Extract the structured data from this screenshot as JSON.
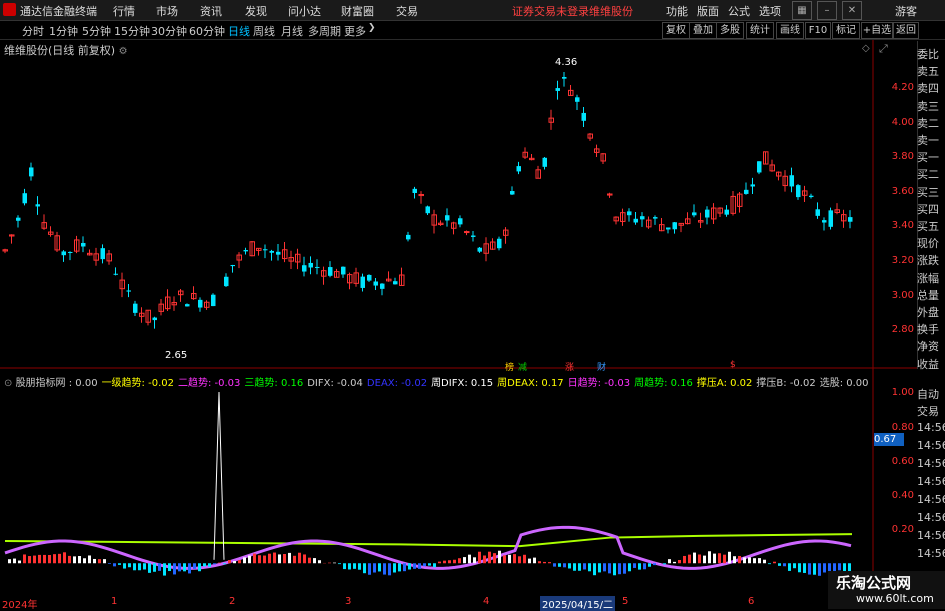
{
  "menubar": {
    "app_title": "通达信金融终端",
    "items": [
      "行情",
      "市场",
      "资讯",
      "发现",
      "问小达",
      "财富圈",
      "交易"
    ],
    "status": "证券交易未登录",
    "stock": "维维股份",
    "right_items": [
      "功能",
      "版面",
      "公式",
      "选项"
    ],
    "user": "游客"
  },
  "toolbar": {
    "periods": [
      "分时",
      "1分钟",
      "5分钟",
      "15分钟",
      "30分钟",
      "60分钟",
      "日线",
      "周线",
      "月线",
      "多周期",
      "更多"
    ],
    "active_period": "日线",
    "more_arrow": "❯",
    "right_buttons": [
      "复权",
      "叠加",
      "多股",
      "统计",
      "画线",
      "F10",
      "标记",
      "+自选",
      "返回"
    ]
  },
  "chart": {
    "title": "维维股份(日线 前复权)",
    "y_ticks": [
      "4.20",
      "4.00",
      "3.80",
      "3.60",
      "3.40",
      "3.20",
      "3.00",
      "2.80"
    ],
    "high_label": "4.36",
    "low_label": "2.65",
    "signals": [
      {
        "text": "榜",
        "color": "#ffcc00"
      },
      {
        "text": "减",
        "color": "#00cc00"
      },
      {
        "text": "涨",
        "color": "#ff3333"
      },
      {
        "text": "财",
        "color": "#3399ff"
      },
      {
        "text": "$",
        "color": "#ff3333"
      }
    ]
  },
  "right_panel": {
    "top": [
      "委比",
      "卖五",
      "卖四",
      "卖三",
      "卖二",
      "卖一",
      "买一",
      "买二",
      "买三",
      "买四",
      "买五",
      "现价",
      "涨跌",
      "涨幅",
      "总量",
      "外盘",
      "换手",
      "净资",
      "收益"
    ],
    "bottom_header": [
      "自动",
      "交易"
    ],
    "times": [
      "14:56",
      "14:56",
      "14:56",
      "14:56",
      "14:56",
      "14:56",
      "14:56",
      "14:56"
    ]
  },
  "indicator": {
    "label_color": "#ccc",
    "parts": [
      {
        "text": "股朋指标网 : 0.00",
        "color": "#cccccc"
      },
      {
        "text": "一级趋势: -0.02",
        "color": "#ffff00"
      },
      {
        "text": "二趋势: -0.03",
        "color": "#ff33ff"
      },
      {
        "text": "三趋势: 0.16",
        "color": "#00ff00"
      },
      {
        "text": "DIFX: -0.04",
        "color": "#cccccc"
      },
      {
        "text": "DEAX: -0.02",
        "color": "#3333ff"
      },
      {
        "text": "周DIFX: 0.15",
        "color": "#ffffff"
      },
      {
        "text": "周DEAX: 0.17",
        "color": "#ffff00"
      },
      {
        "text": "日趋势: -0.03",
        "color": "#ff33ff"
      },
      {
        "text": "周趋势: 0.16",
        "color": "#00ff00"
      },
      {
        "text": "撑压A: 0.02",
        "color": "#ffff00"
      },
      {
        "text": "撑压B: -0.02",
        "color": "#cccccc"
      },
      {
        "text": "选股: 0.00",
        "color": "#cccccc"
      }
    ],
    "y_ticks": [
      "1.00",
      "0.80",
      "0.60",
      "0.40",
      "0.20"
    ],
    "current_value": "0.67"
  },
  "x_axis": {
    "labels": [
      "2024年",
      "1",
      "2",
      "3",
      "4",
      "2025/04/15/二",
      "5",
      "6"
    ]
  },
  "watermark": {
    "title": "乐淘公式网",
    "url": "www.60lt.com"
  },
  "colors": {
    "up": "#ff3333",
    "down": "#00e5ff",
    "ind_purple": "#cc66ff",
    "ind_lime": "#aaff00"
  }
}
